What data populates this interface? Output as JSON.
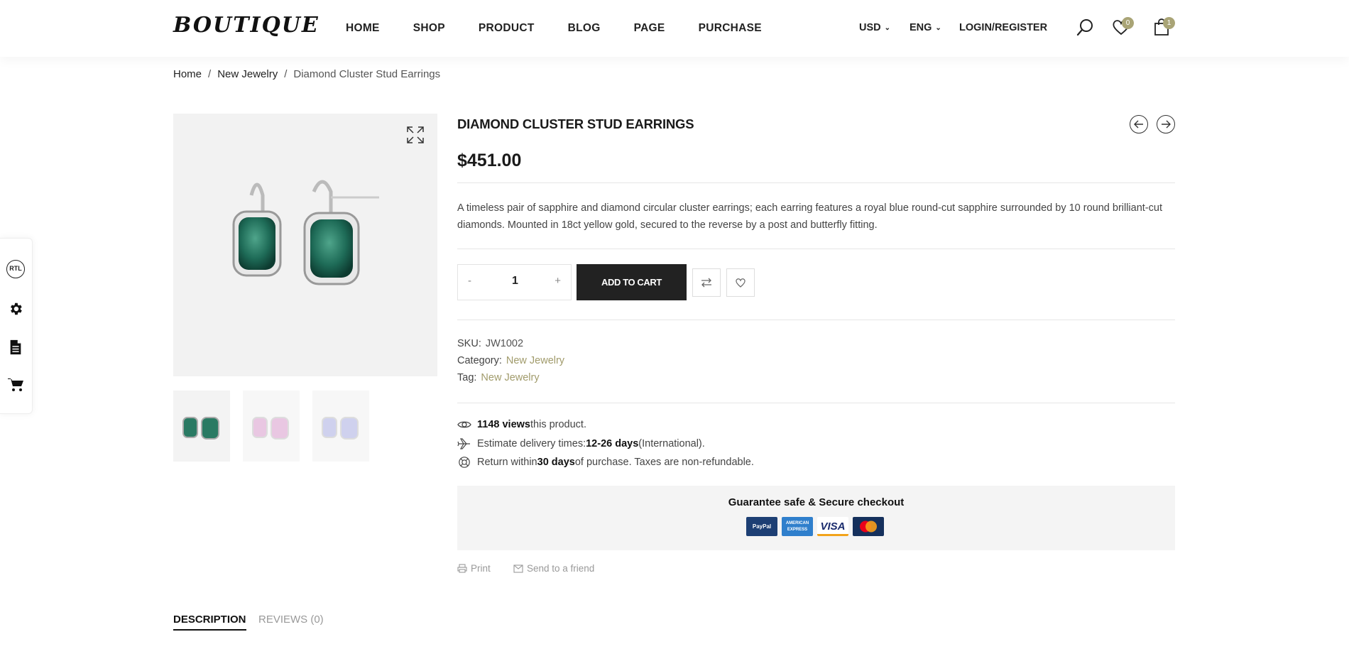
{
  "header": {
    "logo": "BOUTIQUE",
    "nav": [
      "HOME",
      "SHOP",
      "PRODUCT",
      "BLOG",
      "PAGE",
      "PURCHASE"
    ],
    "currency": "USD",
    "language": "ENG",
    "login": "LOGIN/REGISTER",
    "wishlist_count": "0",
    "cart_count": "1"
  },
  "breadcrumb": {
    "home": "Home",
    "category": "New Jewelry",
    "current": "Diamond Cluster Stud Earrings",
    "separator": "/"
  },
  "side_tools": {
    "rtl": "RTL"
  },
  "product": {
    "title": "DIAMOND CLUSTER STUD EARRINGS",
    "price": "$451.00",
    "description": "A timeless pair of sapphire and diamond circular cluster earrings; each earring features a royal blue round-cut sapphire surrounded by 10 round brilliant-cut diamonds. Mounted in 18ct yellow gold, secured to the reverse by a post and butterfly fitting.",
    "quantity": "1",
    "qty_minus": "-",
    "qty_plus": "+",
    "add_to_cart": "ADD TO CART",
    "sku_label": "SKU:",
    "sku": "JW1002",
    "category_label": "Category:",
    "category": "New Jewelry",
    "tag_label": "Tag:",
    "tag": "New Jewelry"
  },
  "info": {
    "views_count": "1148 views",
    "views_suffix": " this product.",
    "delivery_prefix": "Estimate delivery times: ",
    "delivery_days": "12-26 days",
    "delivery_suffix": " (International).",
    "return_prefix": "Return within ",
    "return_days": "30 days",
    "return_suffix": " of purchase. Taxes are non-refundable."
  },
  "checkout": {
    "title": "Guarantee safe & Secure checkout",
    "cards": [
      "PayPal",
      "AMERICAN EXPRESS",
      "VISA",
      "MasterCard"
    ]
  },
  "share": {
    "print": "Print",
    "send": "Send to a friend"
  },
  "tabs": [
    "DESCRIPTION",
    "REVIEWS (0)"
  ],
  "colors": {
    "accent": "#a9a476",
    "dark": "#222222",
    "link": "#a19b6b"
  }
}
